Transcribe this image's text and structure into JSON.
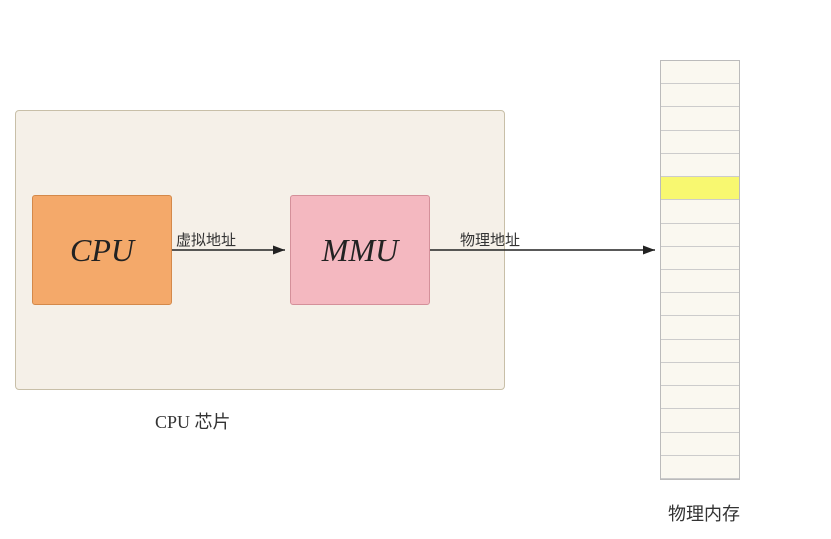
{
  "diagram": {
    "cpu_chip_label": "CPU 芯片",
    "cpu_label": "CPU",
    "mmu_label": "MMU",
    "memory_label": "物理内存",
    "virtual_address_label": "虚拟地址",
    "physical_address_label": "物理地址",
    "memory_rows": 18,
    "highlighted_row": 5,
    "colors": {
      "background": "#ffffff",
      "chip_box": "#f5f0e8",
      "cpu_block": "#f4a96a",
      "mmu_block": "#f4b8c0",
      "memory_highlight": "#f8f870"
    }
  }
}
